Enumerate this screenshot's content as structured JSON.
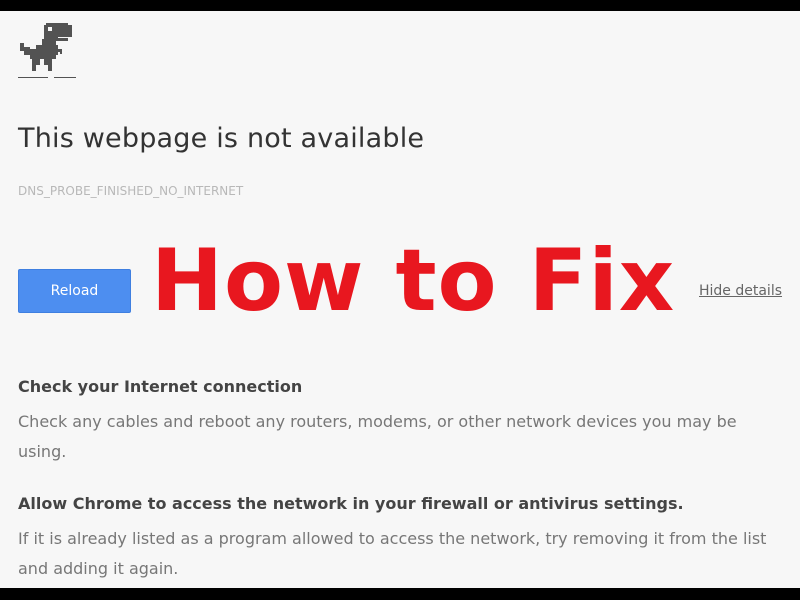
{
  "error_page": {
    "title": "This webpage is not available",
    "error_code": "DNS_PROBE_FINISHED_NO_INTERNET",
    "reload_label": "Reload",
    "details_link": "Hide details",
    "sections": [
      {
        "heading": "Check your Internet connection",
        "body": "Check any cables and reboot any routers, modems, or other network devices you may be using."
      },
      {
        "heading": "Allow Chrome to access the network in your firewall or antivirus settings.",
        "body": "If it is already listed as a program allowed to access the network, try removing it from the list and adding it again."
      }
    ]
  },
  "overlay": {
    "text": "How to Fix",
    "color": "#e8171f"
  },
  "icons": {
    "dino": "offline-dinosaur-icon"
  },
  "colors": {
    "reload_button": "#4d8ef0",
    "background": "#f7f7f7"
  }
}
